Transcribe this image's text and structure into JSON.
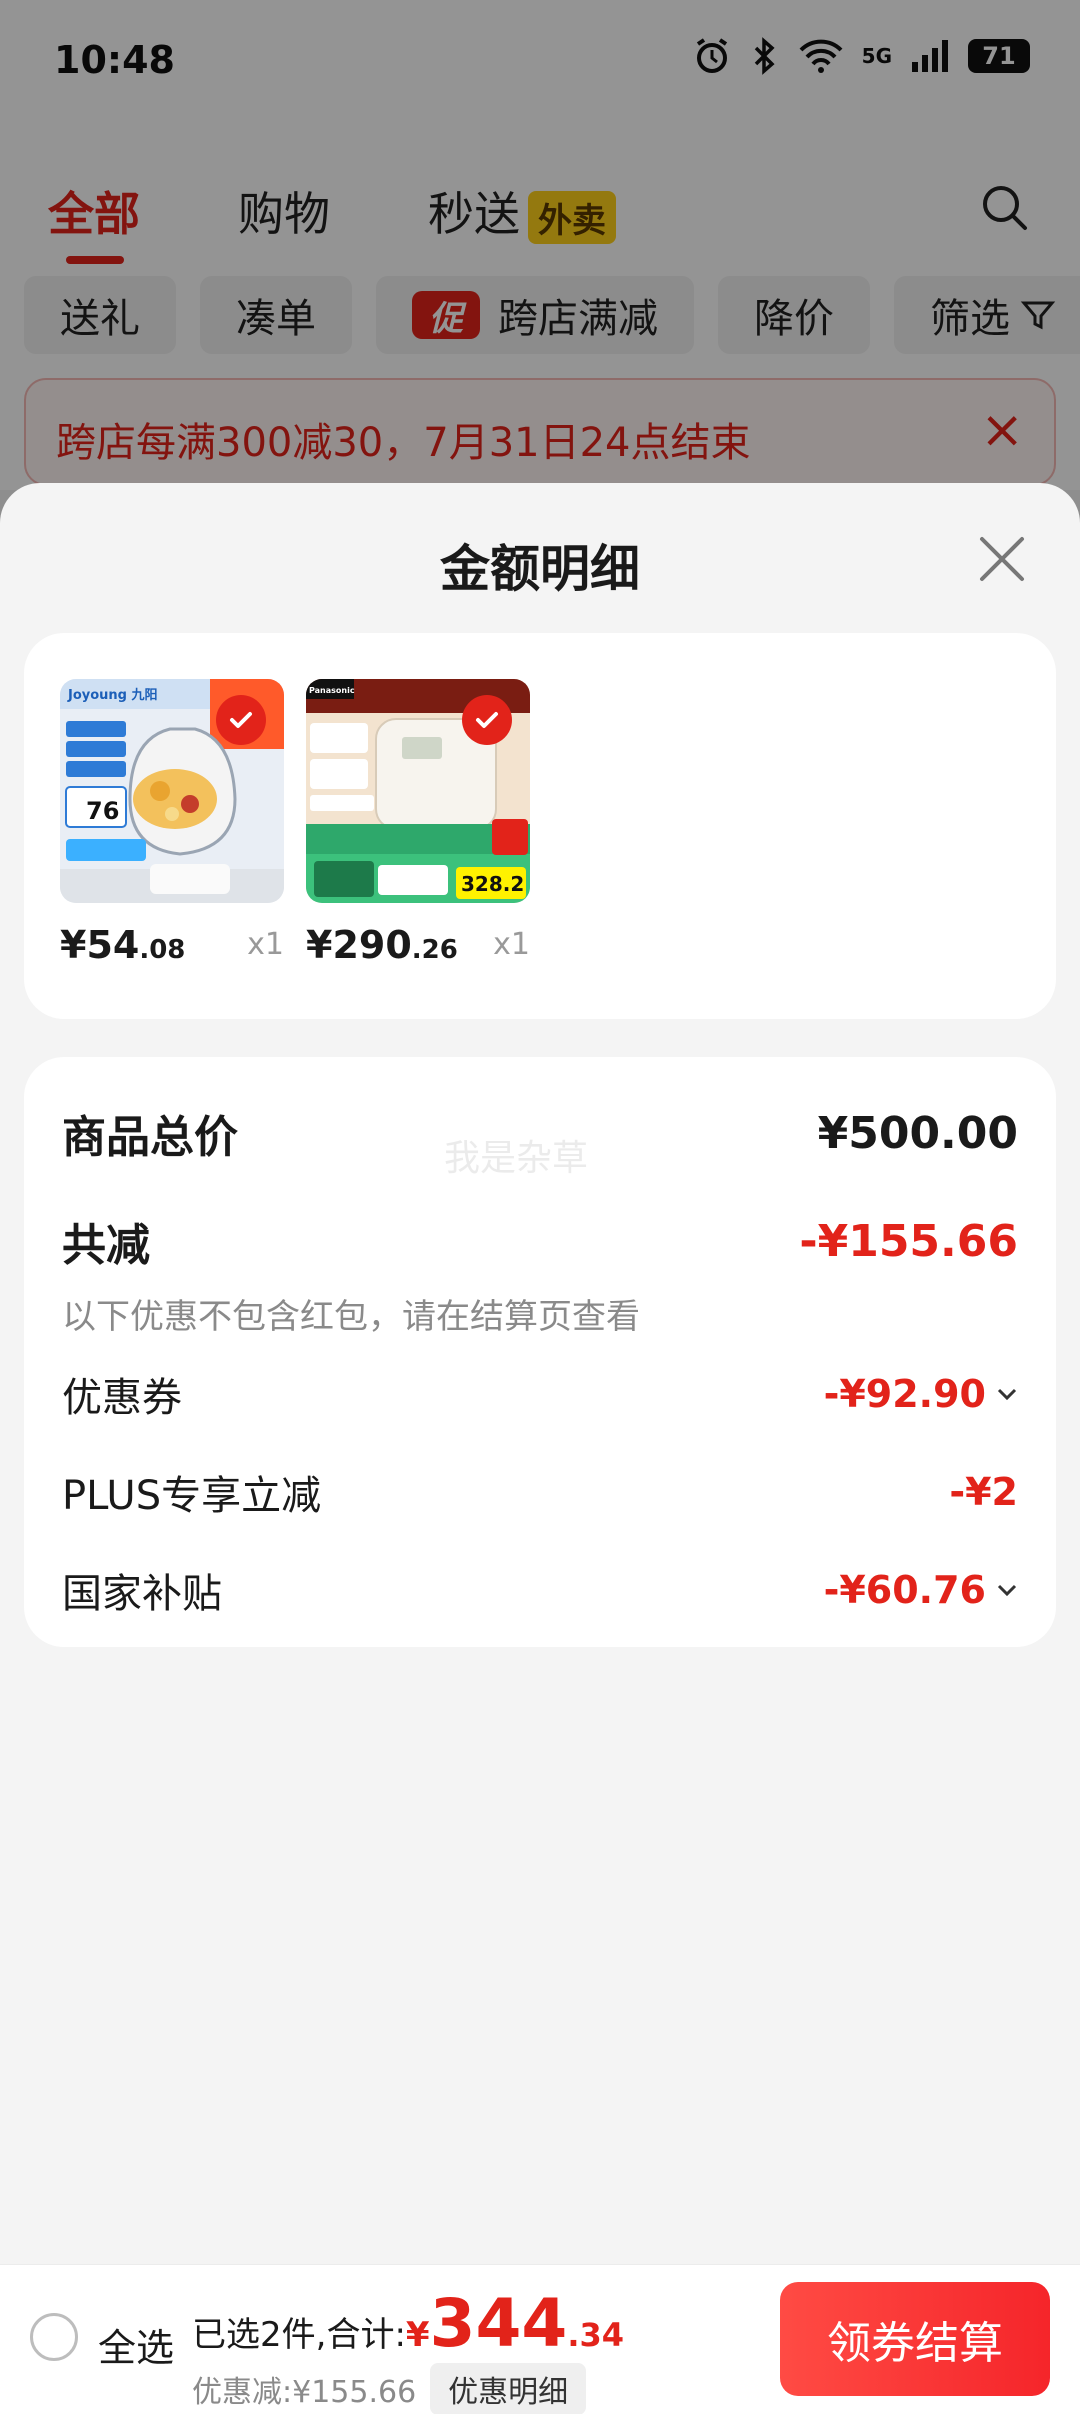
{
  "status_bar": {
    "time": "10:48",
    "network": "5G",
    "battery": "71"
  },
  "top_tabs": {
    "all": "全部",
    "shopping": "购物",
    "instant": "秒送",
    "instant_badge": "外卖"
  },
  "filter_chips": {
    "gift": "送礼",
    "combine": "凑单",
    "promo_tag": "促",
    "cross_store": "跨店满减",
    "price_drop": "降价",
    "filter": "筛选"
  },
  "banner": {
    "text": "跨店每满300减30，7月31日24点结束"
  },
  "sheet": {
    "title": "金额明细",
    "items": [
      {
        "brand": "Joyoung 九阳",
        "img_price": "76",
        "price_int": "¥54",
        "price_dec": ".08",
        "qty": "x1"
      },
      {
        "brand": "Panasonic",
        "img_price": "328.2",
        "price_int": "¥290",
        "price_dec": ".26",
        "qty": "x1"
      }
    ],
    "total_label": "商品总价",
    "total_value": "¥500.00",
    "reduce_label": "共减",
    "reduce_value": "-¥155.66",
    "reduce_note": "以下优惠不包含红包，请在结算页查看",
    "watermark": "我是杂草",
    "coupon_label": "优惠券",
    "coupon_value": "-¥92.90",
    "plus_label": "PLUS专享立减",
    "plus_value": "-¥2",
    "subsidy_label": "国家补贴",
    "subsidy_value": "-¥60.76"
  },
  "bottom_bar": {
    "select_all": "全选",
    "summary_prefix": "已选2件,合计:",
    "currency": "¥",
    "total_int": "344",
    "total_dec": ".34",
    "discount_text": "优惠减:¥155.66",
    "detail_button": "优惠明细",
    "checkout_button": "领券结算"
  },
  "colors": {
    "accent": "#e2231a",
    "badge_yellow": "#ffd11a"
  }
}
